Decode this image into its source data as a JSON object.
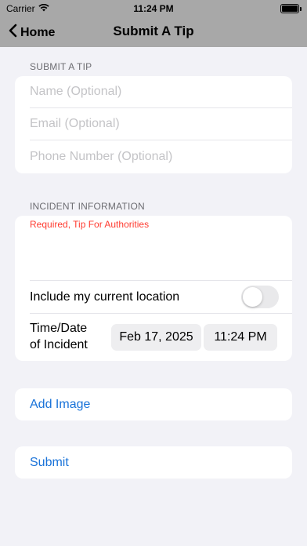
{
  "status_bar": {
    "carrier": "Carrier",
    "time": "11:24 PM"
  },
  "nav": {
    "back_label": "Home",
    "title": "Submit A Tip"
  },
  "tip_section": {
    "header": "SUBMIT A TIP",
    "name_placeholder": "Name (Optional)",
    "email_placeholder": "Email (Optional)",
    "phone_placeholder": "Phone Number (Optional)"
  },
  "incident_section": {
    "header": "INCIDENT INFORMATION",
    "description_placeholder": "Required, Tip For Authorities",
    "location_label": "Include my current location",
    "location_enabled": false,
    "datetime_label_line1": "Time/Date",
    "datetime_label_line2": "of Incident",
    "date_value": "Feb 17, 2025",
    "time_value": "11:24 PM"
  },
  "actions": {
    "add_image_label": "Add Image",
    "submit_label": "Submit"
  },
  "colors": {
    "accent": "#1a73d9",
    "required": "#ff3b30",
    "nav_background": "#a8a8a8"
  }
}
